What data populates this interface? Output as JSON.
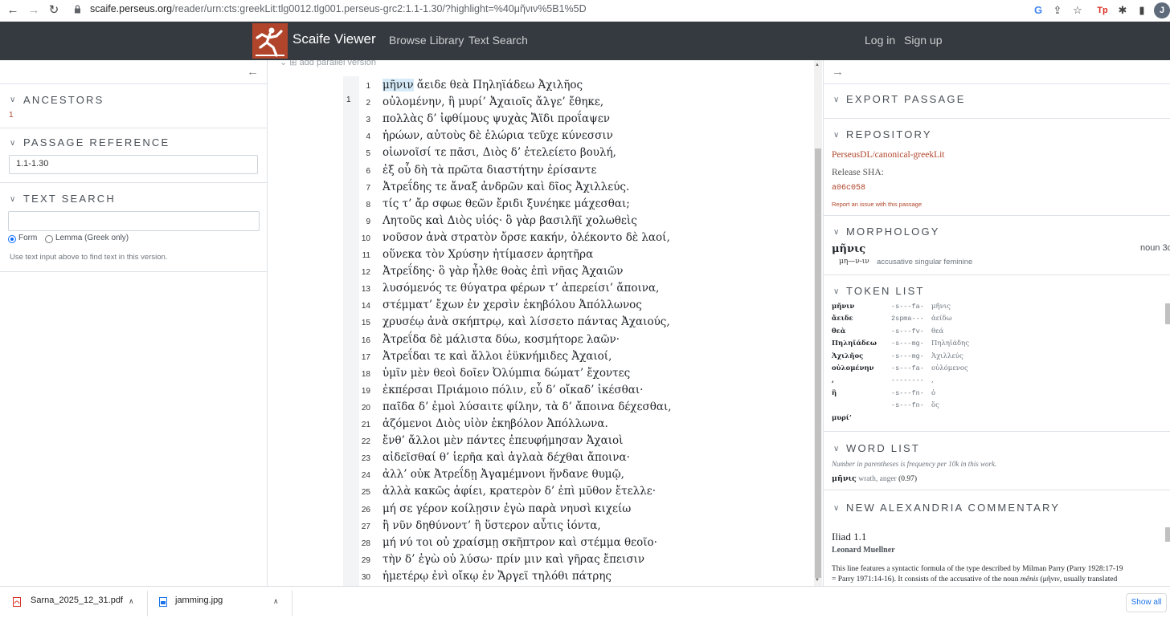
{
  "browser": {
    "url_domain": "scaife.perseus.org",
    "url_rest": "/reader/urn:cts:greekLit:tlg0012.tlg001.perseus-grc2:1.1-1.30/?highlight=%40μῆνιν%5B1%5D",
    "avatar_letter": "J"
  },
  "header": {
    "brand": "Scaife Viewer",
    "nav": [
      "Browse Library",
      "Text Search"
    ],
    "auth": [
      "Log in",
      "Sign up"
    ]
  },
  "left": {
    "ancestors_title": "ANCESTORS",
    "ancestor_link": "1",
    "passage_ref_title": "PASSAGE REFERENCE",
    "passage_ref_value": "1.1-1.30",
    "text_search_title": "TEXT SEARCH",
    "radio_form": "Form",
    "radio_lemma": "Lemma (Greek only)",
    "help_text": "Use text input above to find text in this version."
  },
  "reader": {
    "parallel_label": "add parallel version",
    "book_number": "1",
    "lines": [
      {
        "n": "1",
        "pre_hl": "",
        "hl": "μῆνιν",
        "text": " ἄειδε θεὰ Πηληϊάδεω Ἀχιλῆος"
      },
      {
        "n": "2",
        "pre_hl": "",
        "hl": "",
        "text": "οὐλομένην, ἣ μυρί’ Ἀχαιοῖς ἄλγε’ ἔθηκε,"
      },
      {
        "n": "3",
        "pre_hl": "",
        "hl": "",
        "text": "πολλὰς δ’ ἰφθίμους ψυχὰς Ἄϊδι προΐαψεν"
      },
      {
        "n": "4",
        "pre_hl": "",
        "hl": "",
        "text": "ἡρώων, αὐτοὺς δὲ ἑλώρια τεῦχε κύνεσσιν"
      },
      {
        "n": "5",
        "pre_hl": "",
        "hl": "",
        "text": "οἰωνοῖσί τε πᾶσι, Διὸς δ’ ἐτελείετο βουλή,"
      },
      {
        "n": "6",
        "pre_hl": "",
        "hl": "",
        "text": "ἐξ οὗ δὴ τὰ πρῶτα διαστήτην ἐρίσαντε"
      },
      {
        "n": "7",
        "pre_hl": "",
        "hl": "",
        "text": "Ἀτρεΐδης τε ἄναξ ἀνδρῶν καὶ δῖος Ἀχιλλεύς."
      },
      {
        "n": "8",
        "pre_hl": "",
        "hl": "",
        "text": "τίς τ’ ἄρ σφωε θεῶν ἔριδι ξυνέηκε μάχεσθαι;"
      },
      {
        "n": "9",
        "pre_hl": "",
        "hl": "",
        "text": "Λητοῦς καὶ Διὸς υἱός· ὃ γὰρ βασιλῆϊ χολωθεὶς"
      },
      {
        "n": "10",
        "pre_hl": "",
        "hl": "",
        "text": "νοῦσον ἀνὰ στρατὸν ὄρσε κακήν, ὀλέκοντο δὲ λαοί,"
      },
      {
        "n": "11",
        "pre_hl": "",
        "hl": "",
        "text": "οὕνεκα τὸν Χρύσην ἠτίμασεν ἀρητῆρα"
      },
      {
        "n": "12",
        "pre_hl": "",
        "hl": "",
        "text": "Ἀτρεΐδης· ὃ γὰρ ἦλθε θοὰς ἐπὶ νῆας Ἀχαιῶν"
      },
      {
        "n": "13",
        "pre_hl": "",
        "hl": "",
        "text": "λυσόμενός τε θύγατρα φέρων τ’ ἀπερείσι’ ἄποινα,"
      },
      {
        "n": "14",
        "pre_hl": "",
        "hl": "",
        "text": "στέμματ’ ἔχων ἐν χερσὶν ἑκηβόλου Ἀπόλλωνος"
      },
      {
        "n": "15",
        "pre_hl": "",
        "hl": "",
        "text": "χρυσέῳ ἀνὰ σκήπτρῳ, καὶ λίσσετο πάντας Ἀχαιούς,"
      },
      {
        "n": "16",
        "pre_hl": "",
        "hl": "",
        "text": "Ἀτρεΐδα δὲ μάλιστα δύω, κοσμήτορε λαῶν·"
      },
      {
        "n": "17",
        "pre_hl": "",
        "hl": "",
        "text": "Ἀτρεΐδαι τε καὶ ἄλλοι ἐϋκνήμιδες Ἀχαιοί,"
      },
      {
        "n": "18",
        "pre_hl": "",
        "hl": "",
        "text": "ὑμῖν μὲν θεοὶ δοῖεν Ὀλύμπια δώματ’ ἔχοντες"
      },
      {
        "n": "19",
        "pre_hl": "",
        "hl": "",
        "text": "ἐκπέρσαι Πριάμοιο πόλιν, εὖ δ’ οἴκαδ’ ἱκέσθαι·"
      },
      {
        "n": "20",
        "pre_hl": "",
        "hl": "",
        "text": "παῖδα δ’ ἐμοὶ λύσαιτε φίλην, τὰ δ’ ἄποινα δέχεσθαι,"
      },
      {
        "n": "21",
        "pre_hl": "",
        "hl": "",
        "text": "ἁζόμενοι Διὸς υἱὸν ἑκηβόλον Ἀπόλλωνα."
      },
      {
        "n": "22",
        "pre_hl": "",
        "hl": "",
        "text": "ἔνθ’ ἄλλοι μὲν πάντες ἐπευφήμησαν Ἀχαιοὶ"
      },
      {
        "n": "23",
        "pre_hl": "",
        "hl": "",
        "text": "αἰδεῖσθαί θ’ ἱερῆα καὶ ἀγλαὰ δέχθαι ἄποινα·"
      },
      {
        "n": "24",
        "pre_hl": "",
        "hl": "",
        "text": "ἀλλ’ οὐκ Ἀτρεΐδῃ Ἀγαμέμνονι ἥνδανε θυμῷ,"
      },
      {
        "n": "25",
        "pre_hl": "",
        "hl": "",
        "text": "ἀλλὰ κακῶς ἀφίει, κρατερὸν δ’ ἐπὶ μῦθον ἔτελλε·"
      },
      {
        "n": "26",
        "pre_hl": "",
        "hl": "",
        "text": "μή σε γέρον κοίλῃσιν ἐγὼ παρὰ νηυσὶ κιχείω"
      },
      {
        "n": "27",
        "pre_hl": "",
        "hl": "",
        "text": "ἢ νῦν δηθύνοντ’ ἢ ὕστερον αὖτις ἰόντα,"
      },
      {
        "n": "28",
        "pre_hl": "",
        "hl": "",
        "text": "μή νύ τοι οὐ χραίσμῃ σκῆπτρον καὶ στέμμα θεοῖο·"
      },
      {
        "n": "29",
        "pre_hl": "",
        "hl": "",
        "text": "τὴν δ’ ἐγὼ οὐ λύσω· πρίν μιν καὶ γῆρας ἔπεισιν"
      },
      {
        "n": "30",
        "pre_hl": "",
        "hl": "",
        "text": "ἡμετέρῳ ἐνὶ οἴκῳ ἐν Ἄργεϊ τηλόθι πάτρης"
      }
    ]
  },
  "right": {
    "export_title": "EXPORT PASSAGE",
    "repository_title": "REPOSITORY",
    "repo_link": "PerseusDL/canonical-greekLit",
    "release_sha_label": "Release SHA:",
    "release_sha_value": "a06c058",
    "report_issue": "Report an issue with this passage",
    "morphology_title": "MORPHOLOGY",
    "morph_lemma": "μῆνις",
    "morph_pos": "noun 3d",
    "morph_parse": "μη—ν-ιν",
    "morph_desc": "accusative singular feminine",
    "token_list_title": "TOKEN LIST",
    "tokens": [
      {
        "word": "μῆνιν",
        "tag": "-s---fa-",
        "lemma": "μῆνις"
      },
      {
        "word": "ἄειδε",
        "tag": "2spma---",
        "lemma": "ἀείδω"
      },
      {
        "word": "θεὰ",
        "tag": "-s---fv-",
        "lemma": "θεά"
      },
      {
        "word": "Πηληϊάδεω",
        "tag": "-s---mg-",
        "lemma": "Πηληϊάδης"
      },
      {
        "word": "Ἀχιλῆος",
        "tag": "-s---mg-",
        "lemma": "Ἀχιλλεύς"
      },
      {
        "word": "οὐλομένην",
        "tag": "-s---fa-",
        "lemma": "οὐλόμενος"
      },
      {
        "word": ",",
        "tag": "--------",
        "lemma": ","
      },
      {
        "word": "ἣ",
        "tag": "-s---fn-",
        "lemma": "ὁ"
      },
      {
        "word": "",
        "tag": "-s---fn-",
        "lemma": "ὅς"
      },
      {
        "word": "μυρί’",
        "tag": "",
        "lemma": ""
      }
    ],
    "word_list_title": "WORD LIST",
    "word_list_note": "Number in parentheses is frequency per 10k in this work.",
    "word_list_word": "μῆνις",
    "word_list_gloss": " wrath, anger",
    "word_list_freq": " (0.97)",
    "commentary_title": "NEW ALEXANDRIA COMMENTARY",
    "commentary_heading": "Iliad 1.1",
    "commentary_author": "Leonard Muellner",
    "commentary_body_1": "This line features a syntactic formula of the type described by Milman Parry (Parry 1928:17-19",
    "commentary_body_2": "= Parry 1971:14-16). It consists of the accusative of the noun ",
    "commentary_body_em": "mênis",
    "commentary_body_3": " (μῆνιν, usually translated"
  },
  "downloads": {
    "items": [
      "Sarna_2025_12_31.pdf",
      "jamming.jpg"
    ],
    "show_all": "Show all"
  }
}
